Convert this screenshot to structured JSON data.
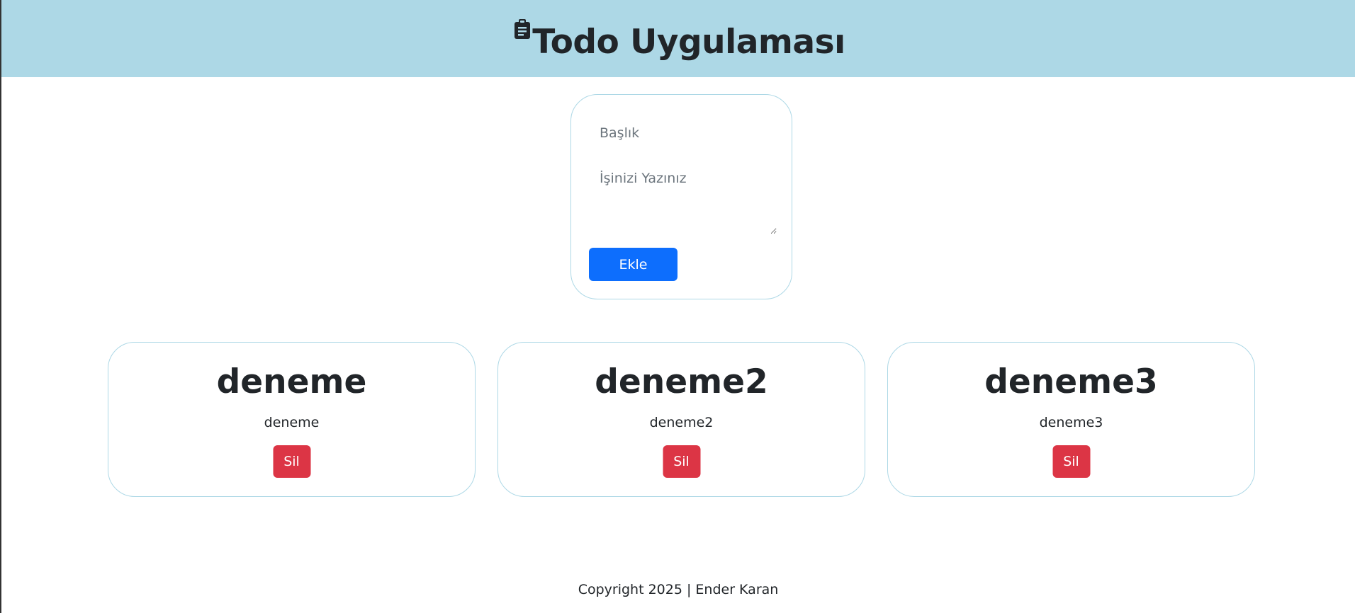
{
  "header": {
    "title": "Todo Uygulaması",
    "icon": "clipboard-icon",
    "background_color": "#add8e6"
  },
  "form": {
    "title_placeholder": "Başlık",
    "title_value": "",
    "description_placeholder": "İşinizi Yazınız",
    "description_value": "",
    "add_label": "Ekle",
    "add_button_color": "#0d6efd"
  },
  "todos": [
    {
      "title": "deneme",
      "description": "deneme",
      "delete_label": "Sil"
    },
    {
      "title": "deneme2",
      "description": "deneme2",
      "delete_label": "Sil"
    },
    {
      "title": "deneme3",
      "description": "deneme3",
      "delete_label": "Sil"
    }
  ],
  "colors": {
    "card_border": "#add8e6",
    "delete_button": "#dc3545"
  },
  "footer": {
    "copyright": "Copyright 2025 | Ender Karan"
  }
}
